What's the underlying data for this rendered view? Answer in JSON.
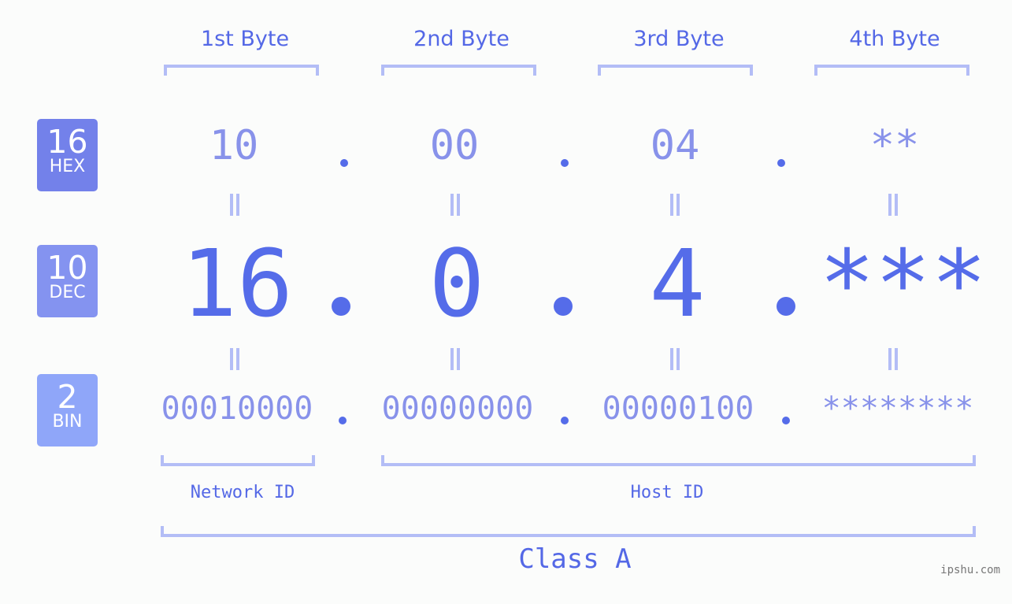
{
  "colors": {
    "accent": "#556ce9",
    "label_text": "#5468e6",
    "light_value": "#8892ea",
    "bracket": "#b3bdf6",
    "hex_badge": "#7381ea",
    "dec_badge": "#8493f0",
    "bin_badge": "#8fa6f9",
    "background": "#fbfcfb"
  },
  "headers": [
    "1st Byte",
    "2nd Byte",
    "3rd Byte",
    "4th Byte"
  ],
  "badges": {
    "hex": {
      "base": "16",
      "label": "HEX"
    },
    "dec": {
      "base": "10",
      "label": "DEC"
    },
    "bin": {
      "base": "2",
      "label": "BIN"
    }
  },
  "hex_values": [
    "10",
    "00",
    "04",
    "**"
  ],
  "dec_values": [
    "16",
    "0",
    "4",
    "***"
  ],
  "bin_values": [
    "00010000",
    "00000000",
    "00000100",
    "********"
  ],
  "labels": {
    "network_id": "Network ID",
    "host_id": "Host ID",
    "class": "Class A"
  },
  "watermark": "ipshu.com"
}
